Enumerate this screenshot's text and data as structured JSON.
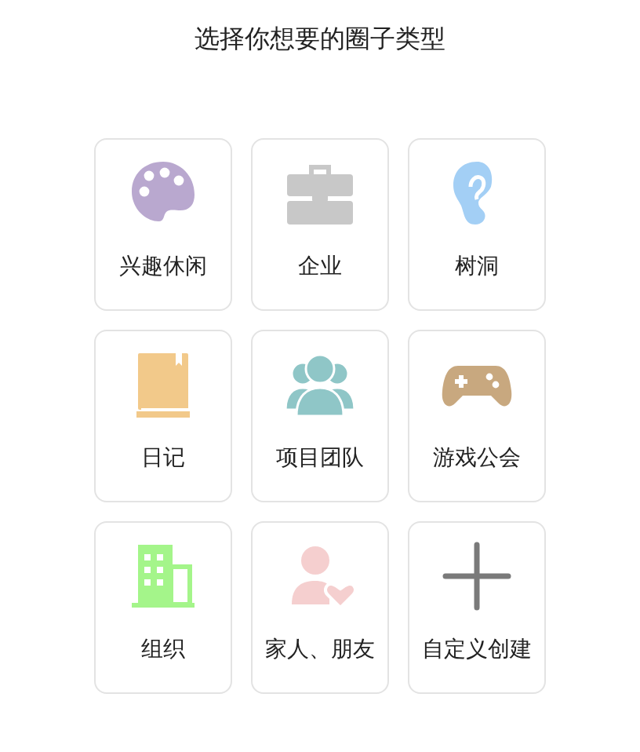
{
  "title": "选择你想要的圈子类型",
  "categories": [
    {
      "kind": "palette",
      "label": "兴趣休闲"
    },
    {
      "kind": "briefcase",
      "label": "企业"
    },
    {
      "kind": "ear",
      "label": "树洞"
    },
    {
      "kind": "book",
      "label": "日记"
    },
    {
      "kind": "team",
      "label": "项目团队"
    },
    {
      "kind": "gamepad",
      "label": "游戏公会"
    },
    {
      "kind": "building",
      "label": "组织"
    },
    {
      "kind": "family",
      "label": "家人、朋友"
    },
    {
      "kind": "plus",
      "label": "自定义创建"
    }
  ]
}
